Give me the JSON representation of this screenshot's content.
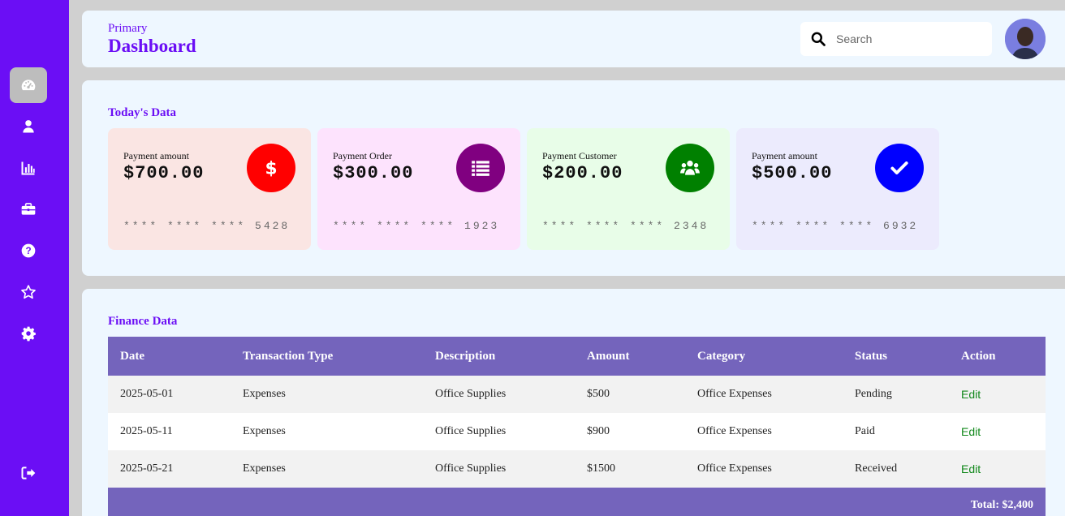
{
  "header": {
    "subtitle": "Primary",
    "title": "Dashboard",
    "search_placeholder": "Search"
  },
  "sidebar": {
    "items": [
      {
        "icon": "dashboard-icon",
        "active": true
      },
      {
        "icon": "user-icon"
      },
      {
        "icon": "chart-icon"
      },
      {
        "icon": "briefcase-icon"
      },
      {
        "icon": "help-icon"
      },
      {
        "icon": "star-icon"
      },
      {
        "icon": "gear-icon"
      },
      {
        "icon": "logout-icon"
      }
    ]
  },
  "today": {
    "title": "Today's Data",
    "cards": [
      {
        "label": "Payment amount",
        "amount": "$700.00",
        "number": "**** **** **** 5428",
        "bg": "#fae5e3",
        "circle": "#ff0000",
        "icon": "dollar-icon"
      },
      {
        "label": "Payment Order",
        "amount": "$300.00",
        "number": "**** **** **** 1923",
        "bg": "#fde3fd",
        "circle": "#800080",
        "icon": "list-icon"
      },
      {
        "label": "Payment Customer",
        "amount": "$200.00",
        "number": "**** **** **** 2348",
        "bg": "#e8fde8",
        "circle": "#008000",
        "icon": "users-icon"
      },
      {
        "label": "Payment amount",
        "amount": "$500.00",
        "number": "**** **** **** 6932",
        "bg": "#ecebfd",
        "circle": "#0000ff",
        "icon": "check-icon"
      }
    ]
  },
  "finance": {
    "title": "Finance Data",
    "columns": [
      "Date",
      "Transaction Type",
      "Description",
      "Amount",
      "Category",
      "Status",
      "Action"
    ],
    "rows": [
      [
        "2025-05-01",
        "Expenses",
        "Office Supplies",
        "$500",
        "Office Expenses",
        "Pending",
        "Edit"
      ],
      [
        "2025-05-11",
        "Expenses",
        "Office Supplies",
        "$900",
        "Office Expenses",
        "Paid",
        "Edit"
      ],
      [
        "2025-05-21",
        "Expenses",
        "Office Supplies",
        "$1500",
        "Office Expenses",
        "Received",
        "Edit"
      ]
    ],
    "total": "Total: $2,400"
  },
  "colors": {
    "accent": "#6b0ef5",
    "table_header": "#7464bc",
    "edit_link": "#11881b"
  }
}
